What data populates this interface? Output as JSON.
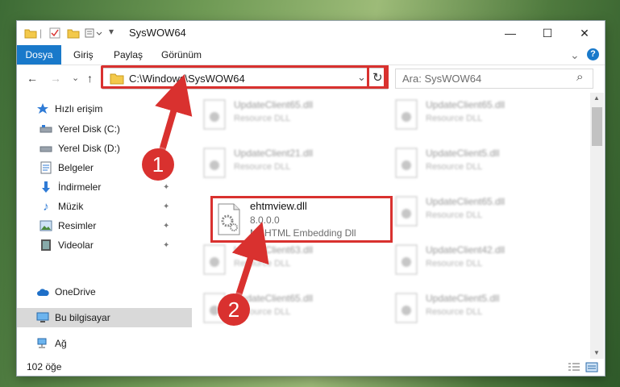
{
  "window": {
    "title": "SysWOW64",
    "min_glyph": "—",
    "max_glyph": "☐",
    "close_glyph": "✕"
  },
  "ribbon": {
    "tabs": [
      {
        "label": "Dosya",
        "active": true
      },
      {
        "label": "Giriş"
      },
      {
        "label": "Paylaş"
      },
      {
        "label": "Görünüm"
      }
    ],
    "collapse_glyph": "⌄",
    "help_glyph": "?"
  },
  "nav": {
    "back_glyph": "←",
    "forward_glyph": "→",
    "recent_glyph": "⌄",
    "up_glyph": "↑",
    "address": "C:\\Windows\\SysWOW64",
    "address_dropdown_glyph": "⌄",
    "refresh_glyph": "↻",
    "search_placeholder": "Ara: SysWOW64",
    "search_glyph": "⌕"
  },
  "sidebar": {
    "items": [
      {
        "label": "Hızlı erişim",
        "icon": "star-icon"
      },
      {
        "label": "Yerel Disk (C:)",
        "icon": "drive-icon"
      },
      {
        "label": "Yerel Disk (D:)",
        "icon": "drive-icon"
      },
      {
        "label": "Belgeler",
        "icon": "documents-icon"
      },
      {
        "label": "İndirmeler",
        "icon": "download-icon"
      },
      {
        "label": "Müzik",
        "icon": "music-icon"
      },
      {
        "label": "Resimler",
        "icon": "pictures-icon"
      },
      {
        "label": "Videolar",
        "icon": "videos-icon"
      },
      {
        "label": "OneDrive",
        "icon": "cloud-icon"
      },
      {
        "label": "Bu bilgisayar",
        "icon": "computer-icon",
        "selected": true
      },
      {
        "label": "Ağ",
        "icon": "network-icon"
      }
    ],
    "pin_glyph": "📌"
  },
  "files": {
    "blurred": [
      {
        "name": "UpdateClient65.dll",
        "sub": "Resource DLL"
      },
      {
        "name": "UpdateClient65.dll",
        "sub": "Resource DLL"
      },
      {
        "name": "UpdateClient21.dll",
        "sub": "Resource DLL"
      },
      {
        "name": "UpdateClient5.dll",
        "sub": "Resource DLL"
      },
      {
        "name": "UpdateClient65.dll",
        "sub": "Resource DLL"
      },
      {
        "name": "UpdateClient63.dll",
        "sub": "Resource DLL"
      },
      {
        "name": "UpdateClient42.dll",
        "sub": "Resource DLL"
      },
      {
        "name": "UpdateClient65.dll",
        "sub": "Resource DLL"
      },
      {
        "name": "UpdateClient5.dll",
        "sub": "Resource DLL"
      }
    ],
    "highlighted": {
      "name": "ehtmview.dll",
      "version": "8.0.0.0",
      "description": "MSHTML Embedding Dll"
    }
  },
  "status": {
    "count": "102 öğe"
  },
  "annotations": {
    "step1": "1",
    "step2": "2"
  },
  "colors": {
    "accent": "#1979ca",
    "highlight": "#d9312f"
  }
}
